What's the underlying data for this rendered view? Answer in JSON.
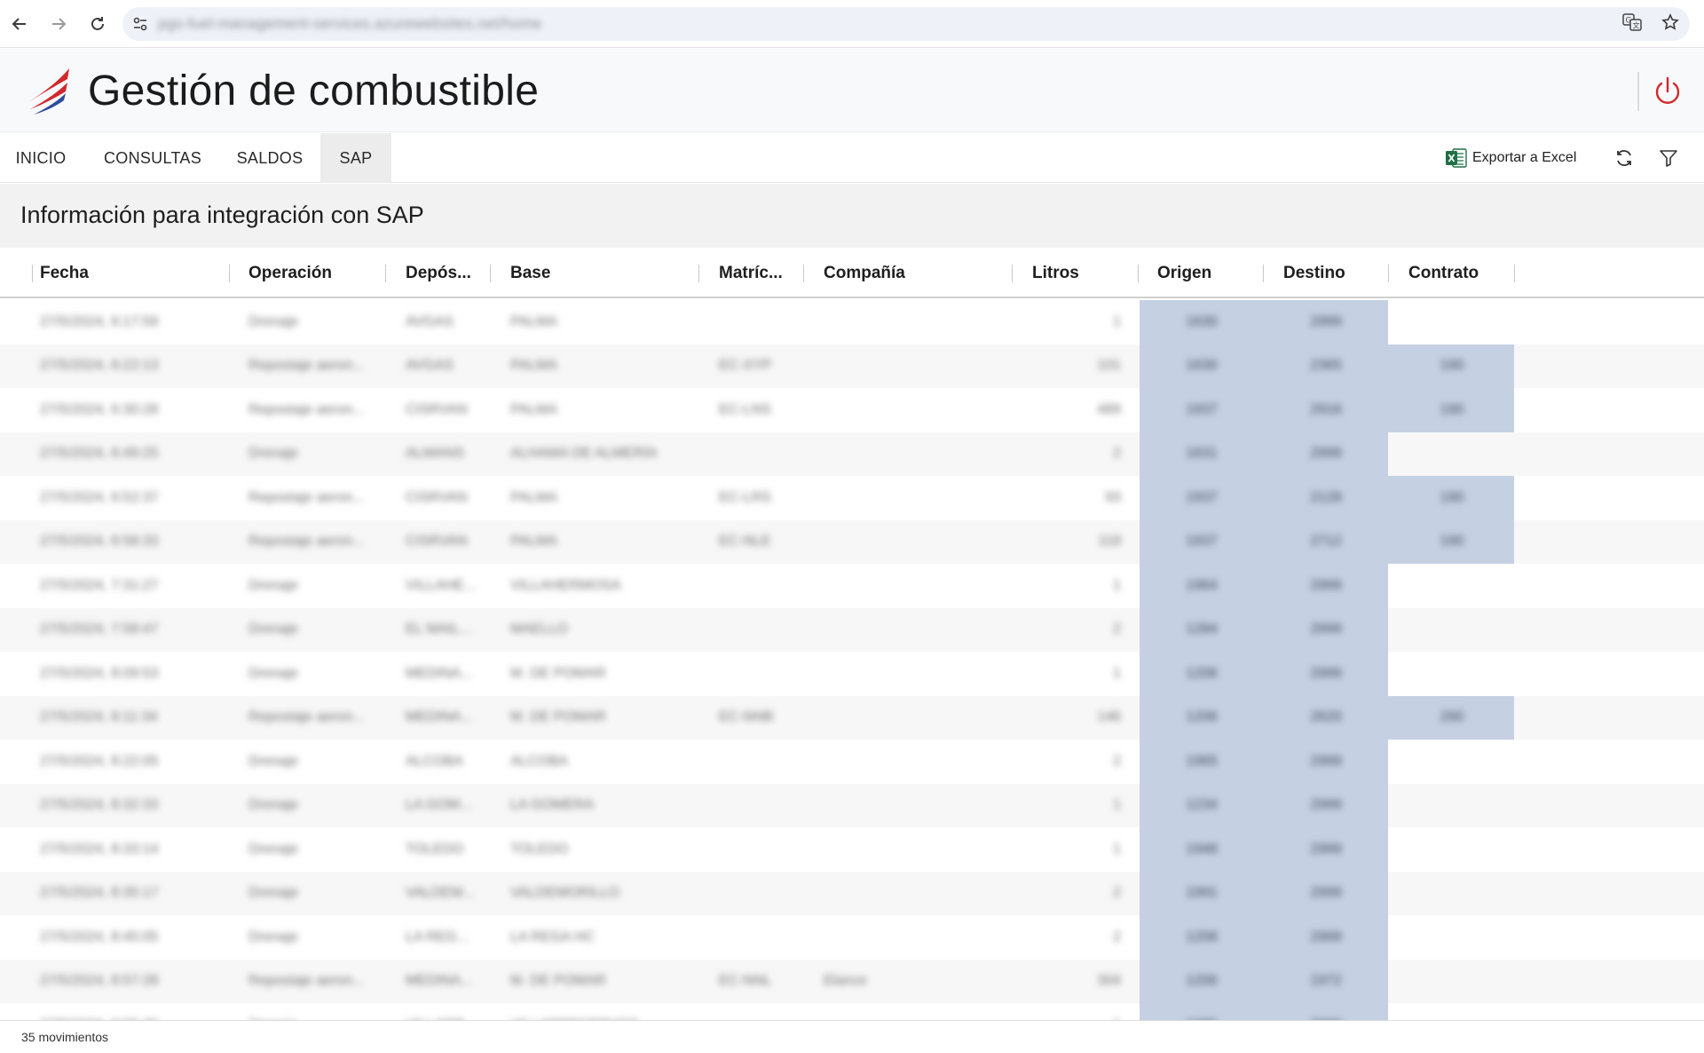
{
  "browser": {
    "url": "pgs-fuel-management-services.azurewebsites.net/home"
  },
  "app": {
    "title": "Gestión de combustible"
  },
  "menu": {
    "items": [
      {
        "label": "INICIO"
      },
      {
        "label": "CONSULTAS"
      },
      {
        "label": "SALDOS"
      },
      {
        "label": "SAP"
      }
    ],
    "export_label": "Exportar a Excel"
  },
  "section": {
    "title": "Información para integración con SAP"
  },
  "table": {
    "headers": [
      "Fecha",
      "Operación",
      "Depós...",
      "Base",
      "Matríc...",
      "Compañía",
      "Litros",
      "Origen",
      "Destino",
      "Contrato"
    ],
    "rows": [
      {
        "fecha": "27/5/2024, 6:17:59",
        "operacion": "Drenaje",
        "deposito": "AVGAS",
        "base": "PALMA",
        "matricula": "",
        "compania": "",
        "litros": "1",
        "origen": "1630",
        "destino": "2999",
        "contrato": ""
      },
      {
        "fecha": "27/5/2024, 6:22:13",
        "operacion": "Repostaje aeron...",
        "deposito": "AVGAS",
        "base": "PALMA",
        "matricula": "EC-XYP",
        "compania": "",
        "litros": "101",
        "origen": "1630",
        "destino": "2365",
        "contrato": "190"
      },
      {
        "fecha": "27/5/2024, 6:30:28",
        "operacion": "Repostaje aeron...",
        "deposito": "CISRVAN",
        "base": "PALMA",
        "matricula": "EC-LNS",
        "compania": "",
        "litros": "489",
        "origen": "1937",
        "destino": "2916",
        "contrato": "190"
      },
      {
        "fecha": "27/5/2024, 6:49:25",
        "operacion": "Drenaje",
        "deposito": "ALMANS",
        "base": "ALHAMA DE ALMERÍA",
        "matricula": "",
        "compania": "",
        "litros": "2",
        "origen": "1631",
        "destino": "2999",
        "contrato": ""
      },
      {
        "fecha": "27/5/2024, 6:52:37",
        "operacion": "Repostaje aeron...",
        "deposito": "CISRVAN",
        "base": "PALMA",
        "matricula": "EC-LRS",
        "compania": "",
        "litros": "93",
        "origen": "1937",
        "destino": "2128",
        "contrato": "190"
      },
      {
        "fecha": "27/5/2024, 6:58:33",
        "operacion": "Repostaje aeron...",
        "deposito": "CISRVAN",
        "base": "PALMA",
        "matricula": "EC-NLE",
        "compania": "",
        "litros": "118",
        "origen": "1937",
        "destino": "2712",
        "contrato": "190"
      },
      {
        "fecha": "27/5/2024, 7:31:27",
        "operacion": "Drenaje",
        "deposito": "VILLAHE...",
        "base": "VILLAHERMOSA",
        "matricula": "",
        "compania": "",
        "litros": "1",
        "origen": "1964",
        "destino": "2999",
        "contrato": ""
      },
      {
        "fecha": "27/5/2024, 7:58:47",
        "operacion": "Drenaje",
        "deposito": "EL MAIL...",
        "base": "MAELLO",
        "matricula": "",
        "compania": "",
        "litros": "2",
        "origen": "1284",
        "destino": "2999",
        "contrato": ""
      },
      {
        "fecha": "27/5/2024, 8:09:53",
        "operacion": "Drenaje",
        "deposito": "MEDINA...",
        "base": "M. DE POMAR",
        "matricula": "",
        "compania": "",
        "litros": "1",
        "origen": "1206",
        "destino": "2999",
        "contrato": ""
      },
      {
        "fecha": "27/5/2024, 8:11:34",
        "operacion": "Repostaje aeron...",
        "deposito": "MEDINA...",
        "base": "M. DE POMAR",
        "matricula": "EC-NNB",
        "compania": "",
        "litros": "146",
        "origen": "1206",
        "destino": "2620",
        "contrato": "290"
      },
      {
        "fecha": "27/5/2024, 8:22:05",
        "operacion": "Drenaje",
        "deposito": "ALCOBA",
        "base": "ALCOBA",
        "matricula": "",
        "compania": "",
        "litros": "2",
        "origen": "1965",
        "destino": "2999",
        "contrato": ""
      },
      {
        "fecha": "27/5/2024, 8:32:33",
        "operacion": "Drenaje",
        "deposito": "LA GOM...",
        "base": "LA GOMERA",
        "matricula": "",
        "compania": "",
        "litros": "1",
        "origen": "1234",
        "destino": "2999",
        "contrato": ""
      },
      {
        "fecha": "27/5/2024, 8:33:14",
        "operacion": "Drenaje",
        "deposito": "TOLEDO",
        "base": "TOLEDO",
        "matricula": "",
        "compania": "",
        "litros": "1",
        "origen": "1948",
        "destino": "2999",
        "contrato": ""
      },
      {
        "fecha": "27/5/2024, 8:35:17",
        "operacion": "Drenaje",
        "deposito": "VALDEM...",
        "base": "VALDEMORILLO",
        "matricula": "",
        "compania": "",
        "litros": "2",
        "origen": "1991",
        "destino": "2999",
        "contrato": ""
      },
      {
        "fecha": "27/5/2024, 8:45:05",
        "operacion": "Drenaje",
        "deposito": "LA REG...",
        "base": "LA REGA HC",
        "matricula": "",
        "compania": "",
        "litros": "2",
        "origen": "1208",
        "destino": "2999",
        "contrato": ""
      },
      {
        "fecha": "27/5/2024, 8:57:28",
        "operacion": "Repostaje aeron...",
        "deposito": "MEDINA...",
        "base": "M. DE POMAR",
        "matricula": "EC-NNL",
        "compania": "Elance",
        "litros": "304",
        "origen": "1206",
        "destino": "1972",
        "contrato": ""
      },
      {
        "fecha": "27/5/2024, 9:05:40",
        "operacion": "Drenaje",
        "deposito": "VILLARR...",
        "base": "VILLARRECERVOS",
        "matricula": "",
        "compania": "",
        "litros": "1",
        "origen": "1985",
        "destino": "2999",
        "contrato": ""
      }
    ],
    "highlight_color": "#c5d1e3"
  },
  "status": {
    "text": "35 movimientos"
  },
  "colors": {
    "accent_red": "#d0292b",
    "excel_green": "#1e7145",
    "highlight": "#c5d1e3"
  }
}
